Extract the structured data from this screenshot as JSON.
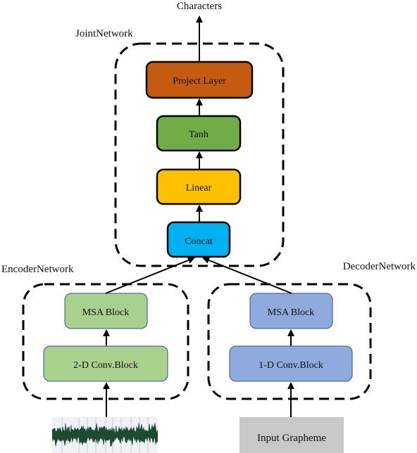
{
  "output_label": "Characters",
  "joint_network": {
    "label": "JointNetwork",
    "blocks": [
      {
        "name": "Project Layer",
        "color": "#c55a11"
      },
      {
        "name": "Tanh",
        "color": "#70ad47"
      },
      {
        "name": "Linear",
        "color": "#ffc000"
      },
      {
        "name": "Concat",
        "color": "#00b0f0"
      }
    ]
  },
  "encoder_network": {
    "label": "EncoderNetwork",
    "blocks": [
      {
        "name": "MSA Block",
        "color": "#a9d18e"
      },
      {
        "name": "2-D Conv.Block",
        "color": "#a9d18e"
      }
    ],
    "input": "audio-waveform"
  },
  "decoder_network": {
    "label": "DecoderNetwork",
    "blocks": [
      {
        "name": "MSA Block",
        "color": "#8faadc"
      },
      {
        "name": "1-D Conv.Block",
        "color": "#8faadc"
      }
    ],
    "input": "Input Grapheme"
  }
}
